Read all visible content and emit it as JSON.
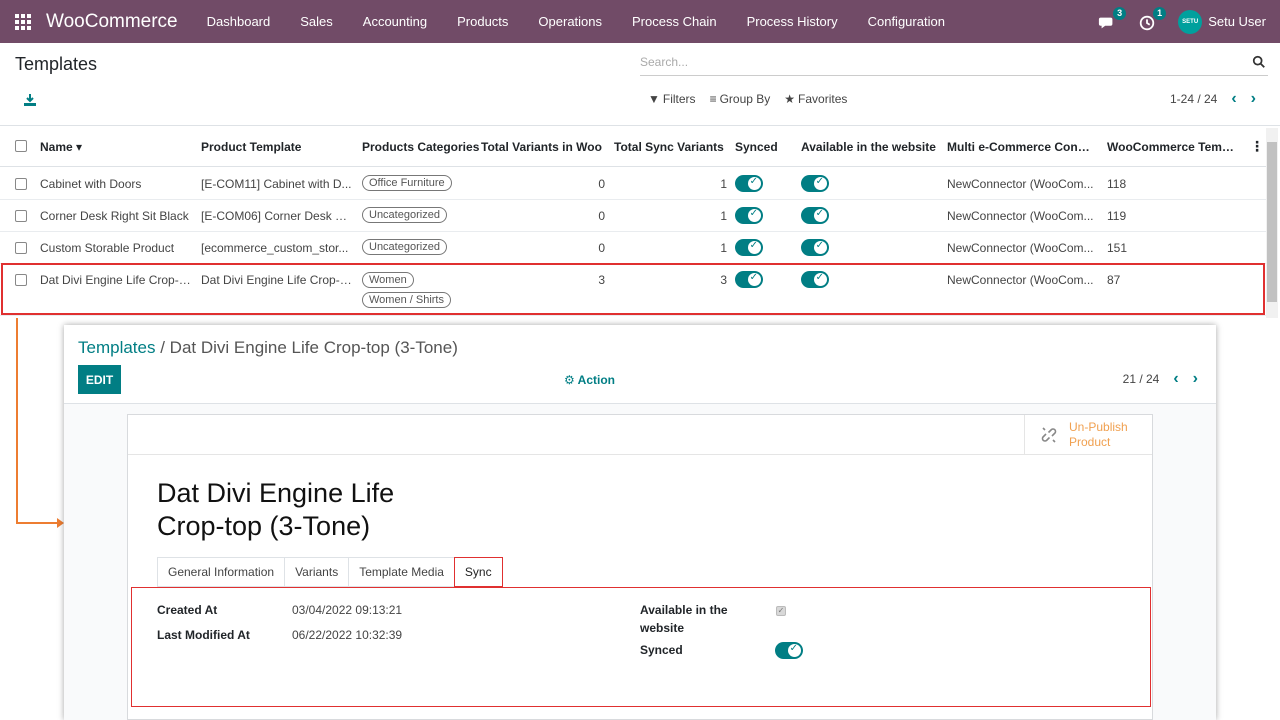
{
  "app": {
    "brand": "WooCommerce",
    "menu": [
      "Dashboard",
      "Sales",
      "Accounting",
      "Products",
      "Operations",
      "Process Chain",
      "Process History",
      "Configuration"
    ],
    "messages_count": "3",
    "activities_count": "1",
    "avatar_text": "SETU",
    "user_name": "Setu User"
  },
  "list_view": {
    "title": "Templates",
    "search_placeholder": "Search...",
    "filters_label": "Filters",
    "group_by_label": "Group By",
    "favorites_label": "Favorites",
    "pager": "1-24 / 24",
    "columns": [
      "Name",
      "Product Template",
      "Products Categories",
      "Total Variants in Woo",
      "Total Sync Variants",
      "Synced",
      "Available in the website",
      "Multi e-Commerce Conn...",
      "WooCommerce Temp..."
    ],
    "rows": [
      {
        "name": "Cabinet with Doors",
        "template": "[E-COM11] Cabinet with D...",
        "categories": [
          "Office Furniture"
        ],
        "total_variants": "0",
        "sync_variants": "1",
        "synced": true,
        "available": true,
        "connector": "NewConnector (WooCom...",
        "woo_id": "118"
      },
      {
        "name": "Corner Desk Right Sit Black",
        "template": "[E-COM06] Corner Desk Ri...",
        "categories": [
          "Uncategorized"
        ],
        "total_variants": "0",
        "sync_variants": "1",
        "synced": true,
        "available": true,
        "connector": "NewConnector (WooCom...",
        "woo_id": "119"
      },
      {
        "name": "Custom Storable Product",
        "template": "[ecommerce_custom_stor...",
        "categories": [
          "Uncategorized"
        ],
        "total_variants": "0",
        "sync_variants": "1",
        "synced": true,
        "available": true,
        "connector": "NewConnector (WooCom...",
        "woo_id": "151"
      },
      {
        "name": "Dat Divi Engine Life Crop-t...",
        "template": "Dat Divi Engine Life Crop-t...",
        "categories": [
          "Women",
          "Women / Shirts"
        ],
        "total_variants": "3",
        "sync_variants": "3",
        "synced": true,
        "available": true,
        "connector": "NewConnector (WooCom...",
        "woo_id": "87"
      }
    ]
  },
  "form_view": {
    "breadcrumb_parent": "Templates",
    "breadcrumb_current": "Dat Divi Engine Life Crop-top (3-Tone)",
    "edit_label": "EDIT",
    "action_label": "Action",
    "pager": "21 / 24",
    "unpublish_label_1": "Un-Publish",
    "unpublish_label_2": "Product",
    "product_name_line1": "Dat Divi Engine Life",
    "product_name_line2": "Crop-top (3-Tone)",
    "tabs": [
      "General Information",
      "Variants",
      "Template Media",
      "Sync"
    ],
    "active_tab": "Sync",
    "created_at_label": "Created At",
    "created_at": "03/04/2022 09:13:21",
    "modified_at_label": "Last Modified At",
    "modified_at": "06/22/2022 10:32:39",
    "available_label_1": "Available in the",
    "available_label_2": "website",
    "available_in_website": true,
    "synced_label": "Synced",
    "synced": true
  },
  "colors": {
    "navbar": "#714b67",
    "primary": "#017e84",
    "highlight": "#e03030",
    "connector": "#ed7d31",
    "unpublish": "#f0a050"
  }
}
